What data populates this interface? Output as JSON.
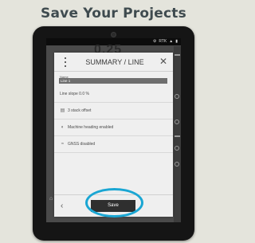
{
  "headline": "Save Your Projects",
  "statusbar": {
    "time": "",
    "signal_label": "RTK"
  },
  "dialog": {
    "title": "SUMMARY / LINE",
    "name_label": "Name",
    "name_value": "Line 1",
    "rows": [
      {
        "label": "Line slope 0.0 %",
        "icon": ""
      },
      {
        "label": "3 stack offset",
        "icon": "stack-icon"
      },
      {
        "label": "Machine heading enabled",
        "icon": "compass-icon"
      },
      {
        "label": "GNSS disabled",
        "icon": "gnss-icon"
      }
    ],
    "save_label": "Save"
  },
  "colors": {
    "highlight": "#1aa6d3",
    "headline": "#3f4b4f",
    "dialog_bg": "#efefef",
    "save_button": "#2f2f2f"
  }
}
